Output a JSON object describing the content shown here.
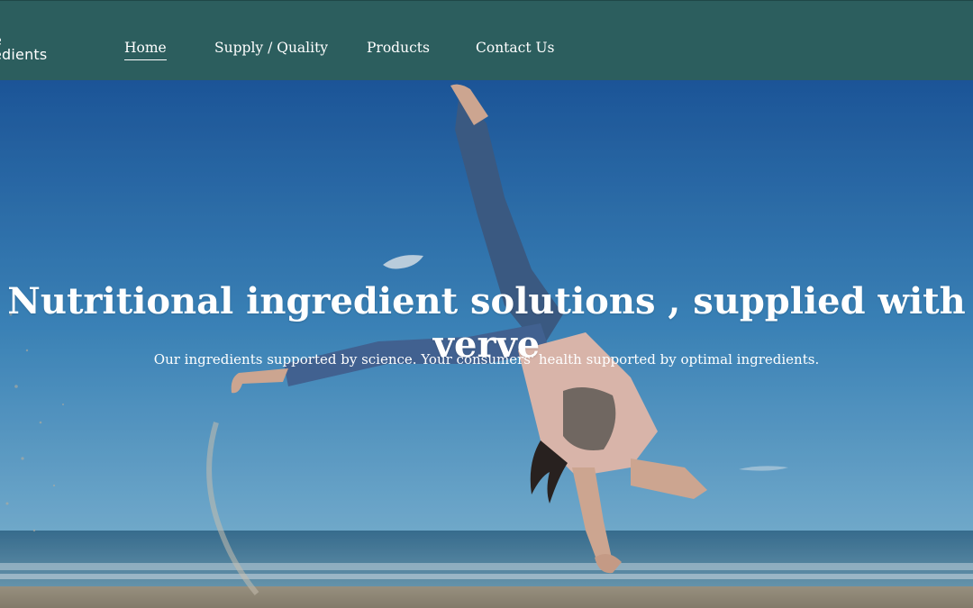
{
  "brand": {
    "logo_line1": "e",
    "logo_line2": "edients"
  },
  "nav": {
    "items": [
      {
        "label": "Home",
        "active": true
      },
      {
        "label": "Supply / Quality",
        "active": false
      },
      {
        "label": "Products",
        "active": false
      },
      {
        "label": "Contact Us",
        "active": false
      }
    ]
  },
  "hero": {
    "title": "Nutritional ingredient solutions , supplied with verve",
    "subtitle": "Our ingredients supported by science.  Your consumers' health supported by optimal ingredients.",
    "image_subject": "person-cartwheel-on-beach"
  },
  "colors": {
    "header_bg": "#2c5e5e",
    "text": "#ffffff",
    "sky_top": "#1f5fa5",
    "sky_bottom": "#6fb0d6",
    "sea": "#4d84a4",
    "sand": "#b4a890"
  }
}
